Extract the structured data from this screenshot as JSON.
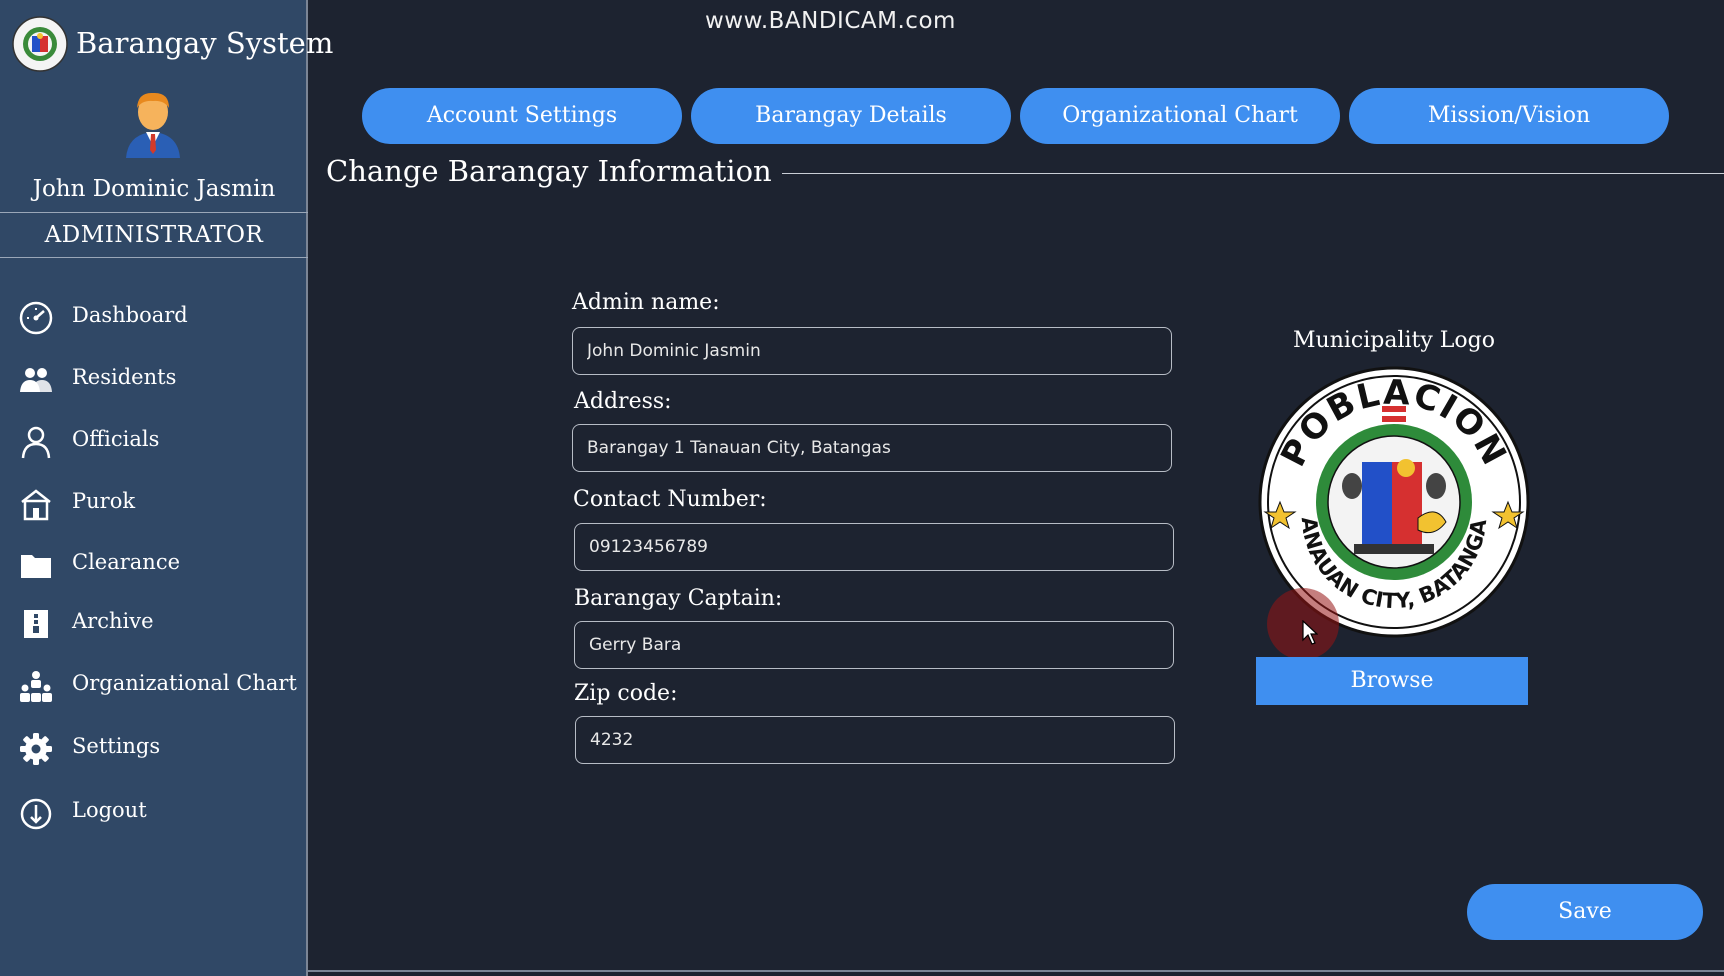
{
  "app": {
    "title": "Barangay System",
    "watermark": "www.BANDICAM.com"
  },
  "user": {
    "name": "John Dominic Jasmin",
    "role": "ADMINISTRATOR"
  },
  "sidebar": {
    "items": [
      {
        "label": "Dashboard",
        "icon": "speedometer-icon"
      },
      {
        "label": "Residents",
        "icon": "users-icon"
      },
      {
        "label": "Officials",
        "icon": "person-icon"
      },
      {
        "label": "Purok",
        "icon": "house-icon"
      },
      {
        "label": "Clearance",
        "icon": "folder-icon"
      },
      {
        "label": "Archive",
        "icon": "archive-icon"
      },
      {
        "label": "Organizational Chart",
        "icon": "org-chart-icon"
      },
      {
        "label": "Settings",
        "icon": "gear-icon"
      },
      {
        "label": "Logout",
        "icon": "power-icon"
      }
    ]
  },
  "tabs": [
    {
      "label": "Account Settings"
    },
    {
      "label": "Barangay Details"
    },
    {
      "label": "Organizational Chart"
    },
    {
      "label": "Mission/Vision"
    }
  ],
  "form": {
    "group_title": "Change Barangay Information",
    "admin_name": {
      "label": "Admin name:",
      "value": "John Dominic Jasmin"
    },
    "address": {
      "label": "Address:",
      "value": "Barangay 1 Tanauan City, Batangas"
    },
    "contact": {
      "label": "Contact Number:",
      "value": "09123456789"
    },
    "captain": {
      "label": "Barangay Captain:",
      "value": "Gerry Bara"
    },
    "zip": {
      "label": "Zip code:",
      "value": "4232"
    }
  },
  "logo": {
    "label": "Municipality Logo",
    "seal_top_text": "POBLACION",
    "seal_bottom_text": "TANAUAN CITY, BATANGAS",
    "browse_label": "Browse"
  },
  "actions": {
    "save_label": "Save"
  },
  "colors": {
    "sidebar_bg": "#304866",
    "main_bg": "#1d2330",
    "accent": "#3f8ff0"
  }
}
